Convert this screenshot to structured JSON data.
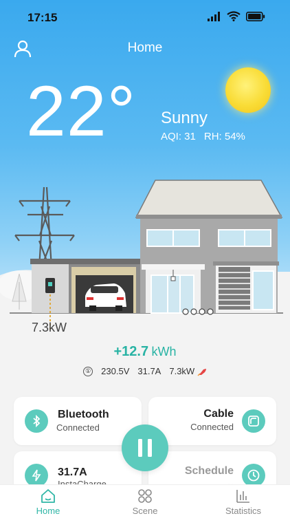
{
  "status_bar": {
    "time": "17:15",
    "icons": [
      "signal-icon",
      "wifi-icon",
      "battery-icon"
    ]
  },
  "header": {
    "title": "Home",
    "profile_icon": "user-icon"
  },
  "weather": {
    "temperature": "22°",
    "condition": "Sunny",
    "aqi": "AQI: 31",
    "rh": "RH: 54%"
  },
  "charger": {
    "power": "7.3kW"
  },
  "session": {
    "energy_value": "+12.7",
    "energy_unit": "kWh",
    "info_glyph": "①",
    "voltage": "230.5V",
    "current": "31.7A",
    "power": "7.3kW"
  },
  "cards": {
    "bluetooth": {
      "title": "Bluetooth",
      "status": "Connected",
      "icon": "bluetooth-icon"
    },
    "cable": {
      "title": "Cable",
      "status": "Connected",
      "icon": "plug-icon"
    },
    "instacharge": {
      "title": "31.7A",
      "status": "InstaCharge",
      "icon": "lightning-icon"
    },
    "schedule": {
      "title": "Schedule",
      "status": "--",
      "icon": "clock-icon"
    }
  },
  "control": {
    "icon": "pause-icon"
  },
  "tabs": [
    {
      "label": "Home",
      "icon": "home-icon",
      "active": true
    },
    {
      "label": "Scene",
      "icon": "scene-grid-icon",
      "active": false
    },
    {
      "label": "Statistics",
      "icon": "bar-chart-icon",
      "active": false
    }
  ],
  "colors": {
    "accent": "#5ccbbd",
    "accent_text": "#28b3a4",
    "sky_top": "#3aa9ee",
    "sun": "#f9dc36"
  }
}
